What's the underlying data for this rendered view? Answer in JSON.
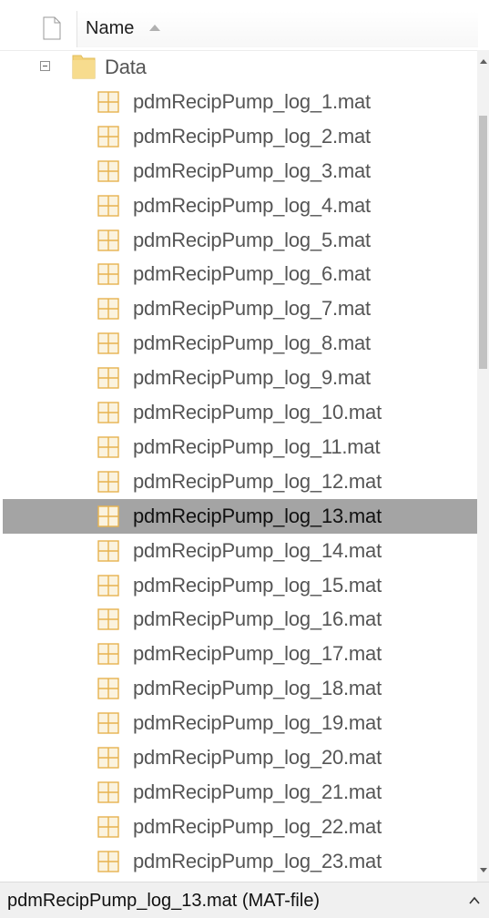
{
  "header": {
    "column_name": "Name",
    "sort_icon": "sort-ascending-icon"
  },
  "tree": {
    "folder": {
      "label": "Data",
      "expanded": true,
      "icon": "folder-icon"
    },
    "files": [
      "pdmRecipPump_log_1.mat",
      "pdmRecipPump_log_2.mat",
      "pdmRecipPump_log_3.mat",
      "pdmRecipPump_log_4.mat",
      "pdmRecipPump_log_5.mat",
      "pdmRecipPump_log_6.mat",
      "pdmRecipPump_log_7.mat",
      "pdmRecipPump_log_8.mat",
      "pdmRecipPump_log_9.mat",
      "pdmRecipPump_log_10.mat",
      "pdmRecipPump_log_11.mat",
      "pdmRecipPump_log_12.mat",
      "pdmRecipPump_log_13.mat",
      "pdmRecipPump_log_14.mat",
      "pdmRecipPump_log_15.mat",
      "pdmRecipPump_log_16.mat",
      "pdmRecipPump_log_17.mat",
      "pdmRecipPump_log_18.mat",
      "pdmRecipPump_log_19.mat",
      "pdmRecipPump_log_20.mat",
      "pdmRecipPump_log_21.mat",
      "pdmRecipPump_log_22.mat",
      "pdmRecipPump_log_23.mat"
    ],
    "selected_index": 12,
    "file_icon": "mat-file-icon"
  },
  "colors": {
    "selection": "#a4a4a4",
    "folder": "#f3d27a",
    "file_icon": "#e7b24f"
  },
  "status_bar": {
    "text": "pdmRecipPump_log_13.mat  (MAT-file)",
    "toggle_icon": "chevron-up-icon"
  }
}
